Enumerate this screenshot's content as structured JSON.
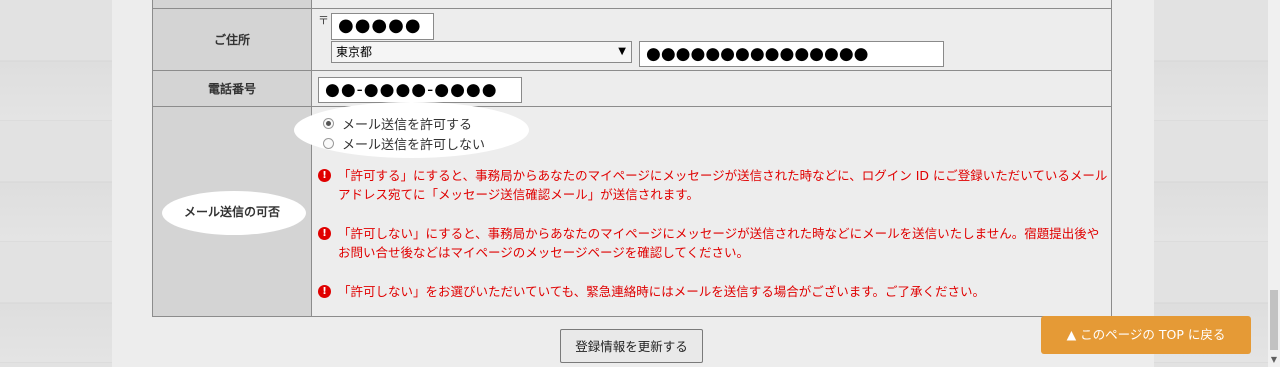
{
  "address": {
    "label": "ご住所",
    "postal_mark": "〒",
    "postal_value": "●●●●●",
    "prefecture": "東京都",
    "street_value": "●●●●●●●●●●●●●●●"
  },
  "phone": {
    "label": "電話番号",
    "value": "●●-●●●●-●●●●"
  },
  "mail": {
    "label": "メール送信の可否",
    "options": [
      {
        "label": "メール送信を許可する",
        "selected": true
      },
      {
        "label": "メール送信を許可しない",
        "selected": false
      }
    ],
    "notices": [
      "「許可する」にすると、事務局からあなたのマイページにメッセージが送信された時などに、ログイン ID にご登録いただいているメールアドレス宛てに「メッセージ送信確認メール」が送信されます。",
      "「許可しない」にすると、事務局からあなたのマイページにメッセージが送信された時などにメールを送信いたしません。宿題提出後やお問い合せ後などはマイページのメッセージページを確認してください。",
      "「許可しない」をお選びいただいていても、緊急連絡時にはメールを送信する場合がございます。ご了承ください。"
    ],
    "warn_glyph": "!"
  },
  "buttons": {
    "update": "登録情報を更新する",
    "back_to_top": "▲ このページの TOP に戻る"
  },
  "colors": {
    "notice_red": "#e00000",
    "top_button": "#e59a36"
  }
}
